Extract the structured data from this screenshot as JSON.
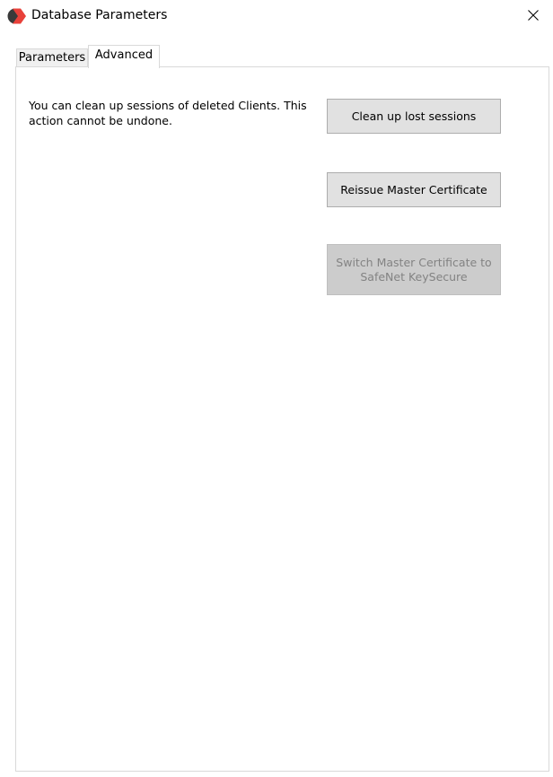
{
  "window": {
    "title": "Database Parameters",
    "close_glyph": "✕"
  },
  "icons": {
    "app": "app-logo-icon",
    "close": "close-icon"
  },
  "colors": {
    "app_icon_red": "#e8413a",
    "app_icon_dark": "#3a3a3a",
    "button_face": "#e1e1e1",
    "button_disabled_face": "#cccccc",
    "disabled_text": "#838383"
  },
  "tabs": [
    {
      "label": "Parameters",
      "selected": false
    },
    {
      "label": "Advanced",
      "selected": true
    }
  ],
  "advanced": {
    "description": "You can clean up sessions of deleted Clients. This action cannot be undone.",
    "buttons": {
      "cleanup": "Clean up lost sessions",
      "reissue": "Reissue Master Certificate",
      "switch": "Switch Master Certificate to SafeNet KeySecure"
    },
    "switch_enabled": false
  }
}
